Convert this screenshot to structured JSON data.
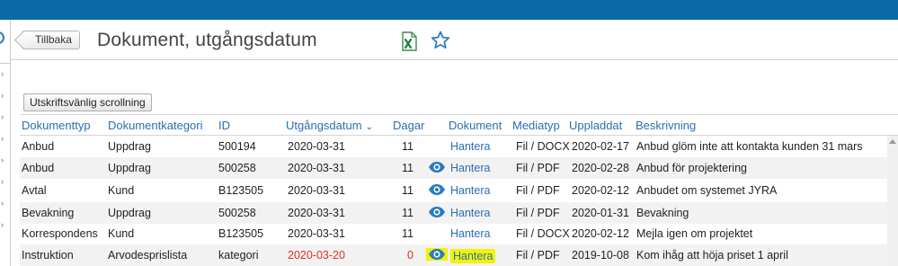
{
  "header": {
    "back_label": "Tillbaka",
    "title": "Dokument, utgångsdatum",
    "excel_icon": "excel-export-icon",
    "star_icon": "star-icon",
    "accent": "#0b6aa8"
  },
  "toolbar": {
    "print_label": "Utskriftsvänlig scrollning"
  },
  "table": {
    "headers": {
      "type": "Dokumenttyp",
      "category": "Dokumentkategori",
      "id": "ID",
      "expiry": "Utgångsdatum",
      "days": "Dagar",
      "document": "Dokument",
      "mediatype": "Mediatyp",
      "uploaded": "Uppladdat",
      "description": "Beskrivning"
    },
    "sort_column": "expiry",
    "rows": [
      {
        "type": "Anbud",
        "category": "Uppdrag",
        "id": "500194",
        "expiry": "2020-03-31",
        "days": "11",
        "eye": false,
        "document": "Hantera",
        "mediatype": "Fil / DOCX",
        "uploaded": "2020-02-17",
        "description": "Anbud glöm inte att kontakta kunden 31 mars"
      },
      {
        "type": "Anbud",
        "category": "Uppdrag",
        "id": "500258",
        "expiry": "2020-03-31",
        "days": "11",
        "eye": true,
        "document": "Hantera",
        "mediatype": "Fil / PDF",
        "uploaded": "2020-02-28",
        "description": "Anbud för projektering"
      },
      {
        "type": "Avtal",
        "category": "Kund",
        "id": "B123505",
        "expiry": "2020-03-31",
        "days": "11",
        "eye": true,
        "document": "Hantera",
        "mediatype": "Fil / PDF",
        "uploaded": "2020-02-12",
        "description": "Anbudet om systemet JYRA"
      },
      {
        "type": "Bevakning",
        "category": "Uppdrag",
        "id": "500258",
        "expiry": "2020-03-31",
        "days": "11",
        "eye": true,
        "document": "Hantera",
        "mediatype": "Fil / PDF",
        "uploaded": "2020-01-31",
        "description": "Bevakning"
      },
      {
        "type": "Korrespondens",
        "category": "Kund",
        "id": "B123505",
        "expiry": "2020-03-31",
        "days": "11",
        "eye": false,
        "document": "Hantera",
        "mediatype": "Fil / DOCX",
        "uploaded": "2020-02-12",
        "description": "Mejla igen om projektet"
      },
      {
        "type": "Instruktion",
        "category": "Arvodesprislista",
        "id": "kategori",
        "expiry": "2020-03-20",
        "days": "0",
        "eye": true,
        "document": "Hantera",
        "mediatype": "Fil / PDF",
        "uploaded": "2019-10-08",
        "description": "Kom ihåg att höja priset 1 april",
        "expired": true,
        "highlight": true
      }
    ]
  },
  "colors": {
    "link": "#2a6fb0",
    "expired": "#e0301e",
    "highlight": "#f2f20a"
  }
}
